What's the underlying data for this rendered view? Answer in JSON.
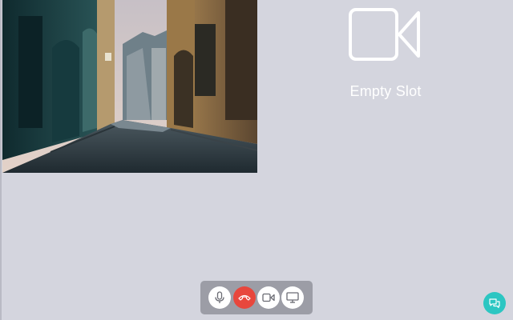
{
  "empty_slot": {
    "label": "Empty Slot",
    "icon": "video-camera-outline-icon"
  },
  "video_tile": {
    "content": "remote-video-stream"
  },
  "controls": {
    "buttons": [
      {
        "icon": "microphone-icon"
      },
      {
        "icon": "hang-up-icon",
        "color": "#e8473d"
      },
      {
        "icon": "video-camera-icon"
      },
      {
        "icon": "screen-share-icon"
      }
    ]
  },
  "chat": {
    "icon": "chat-bubbles-icon",
    "color": "#2cc6c2"
  },
  "colors": {
    "background": "#d4d5de",
    "control_bar": "#9c9da6",
    "hangup": "#e8473d",
    "chat": "#2cc6c2"
  }
}
